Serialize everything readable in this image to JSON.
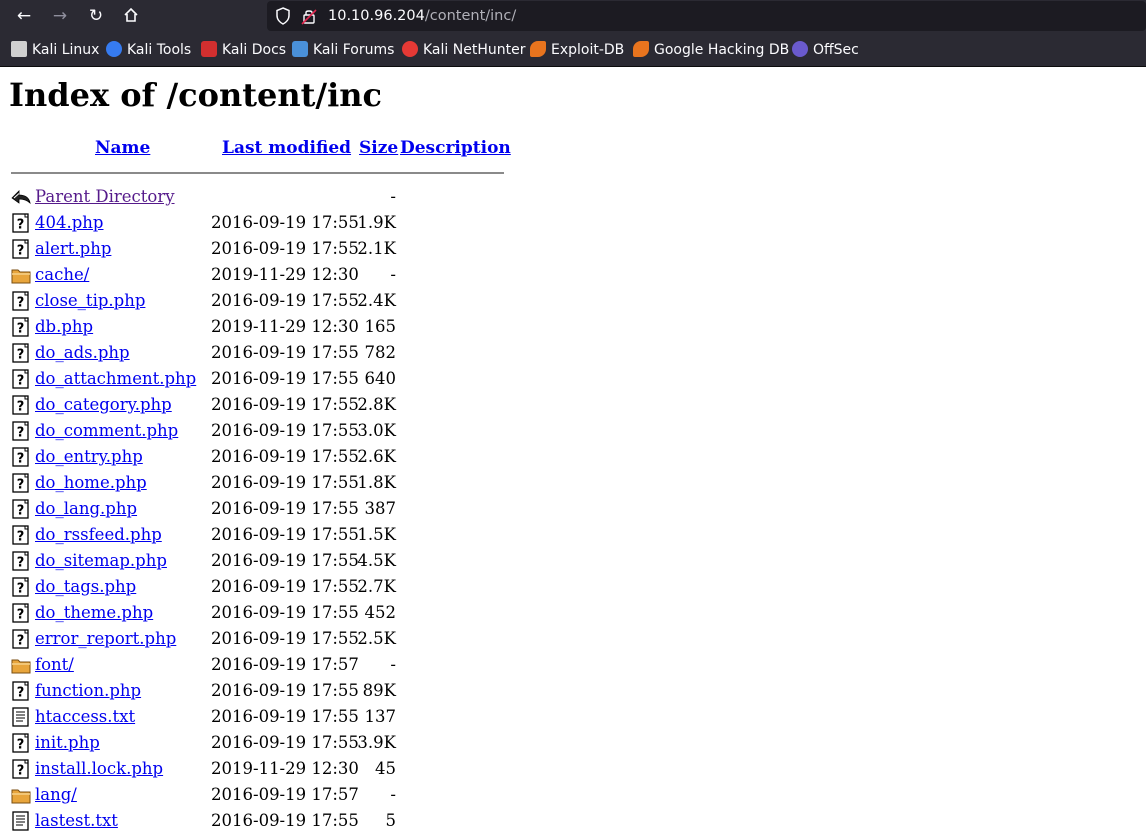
{
  "browser": {
    "url_host": "10.10.96.204",
    "url_path": "/content/inc/",
    "nav": {
      "back_icon": "back-arrow-icon",
      "forward_icon": "forward-arrow-icon",
      "reload_icon": "reload-icon",
      "home_icon": "home-icon"
    },
    "bookmarks": [
      {
        "label": "Kali Linux",
        "icon": "kali-linux-icon",
        "color": "#d0d0d0"
      },
      {
        "label": "Kali Tools",
        "icon": "kali-tools-icon",
        "color": "#367bf0"
      },
      {
        "label": "Kali Docs",
        "icon": "kali-docs-icon",
        "color": "#d32f2f"
      },
      {
        "label": "Kali Forums",
        "icon": "kali-forums-icon",
        "color": "#4a90d9"
      },
      {
        "label": "Kali NetHunter",
        "icon": "kali-nethunter-icon",
        "color": "#e53935"
      },
      {
        "label": "Exploit-DB",
        "icon": "exploit-db-icon",
        "color": "#e8741e"
      },
      {
        "label": "Google Hacking DB",
        "icon": "ghdb-icon",
        "color": "#e8741e"
      },
      {
        "label": "OffSec",
        "icon": "offsec-icon",
        "color": "#6a5acd"
      }
    ]
  },
  "page": {
    "title": "Index of /content/inc",
    "columns": {
      "name": "Name",
      "last_modified": "Last modified",
      "size": "Size",
      "description": "Description"
    },
    "rows": [
      {
        "name": "Parent Directory",
        "modified": "",
        "size": "-",
        "icon": "back-icon"
      },
      {
        "name": "404.php",
        "modified": "2016-09-19 17:55",
        "size": "1.9K",
        "icon": "unknown-file-icon"
      },
      {
        "name": "alert.php",
        "modified": "2016-09-19 17:55",
        "size": "2.1K",
        "icon": "unknown-file-icon"
      },
      {
        "name": "cache/",
        "modified": "2019-11-29 12:30",
        "size": "-",
        "icon": "folder-icon"
      },
      {
        "name": "close_tip.php",
        "modified": "2016-09-19 17:55",
        "size": "2.4K",
        "icon": "unknown-file-icon"
      },
      {
        "name": "db.php",
        "modified": "2019-11-29 12:30",
        "size": "165",
        "icon": "unknown-file-icon"
      },
      {
        "name": "do_ads.php",
        "modified": "2016-09-19 17:55",
        "size": "782",
        "icon": "unknown-file-icon"
      },
      {
        "name": "do_attachment.php",
        "modified": "2016-09-19 17:55",
        "size": "640",
        "icon": "unknown-file-icon"
      },
      {
        "name": "do_category.php",
        "modified": "2016-09-19 17:55",
        "size": "2.8K",
        "icon": "unknown-file-icon"
      },
      {
        "name": "do_comment.php",
        "modified": "2016-09-19 17:55",
        "size": "3.0K",
        "icon": "unknown-file-icon"
      },
      {
        "name": "do_entry.php",
        "modified": "2016-09-19 17:55",
        "size": "2.6K",
        "icon": "unknown-file-icon"
      },
      {
        "name": "do_home.php",
        "modified": "2016-09-19 17:55",
        "size": "1.8K",
        "icon": "unknown-file-icon"
      },
      {
        "name": "do_lang.php",
        "modified": "2016-09-19 17:55",
        "size": "387",
        "icon": "unknown-file-icon"
      },
      {
        "name": "do_rssfeed.php",
        "modified": "2016-09-19 17:55",
        "size": "1.5K",
        "icon": "unknown-file-icon"
      },
      {
        "name": "do_sitemap.php",
        "modified": "2016-09-19 17:55",
        "size": "4.5K",
        "icon": "unknown-file-icon"
      },
      {
        "name": "do_tags.php",
        "modified": "2016-09-19 17:55",
        "size": "2.7K",
        "icon": "unknown-file-icon"
      },
      {
        "name": "do_theme.php",
        "modified": "2016-09-19 17:55",
        "size": "452",
        "icon": "unknown-file-icon"
      },
      {
        "name": "error_report.php",
        "modified": "2016-09-19 17:55",
        "size": "2.5K",
        "icon": "unknown-file-icon"
      },
      {
        "name": "font/",
        "modified": "2016-09-19 17:57",
        "size": "-",
        "icon": "folder-icon"
      },
      {
        "name": "function.php",
        "modified": "2016-09-19 17:55",
        "size": "89K",
        "icon": "unknown-file-icon"
      },
      {
        "name": "htaccess.txt",
        "modified": "2016-09-19 17:55",
        "size": "137",
        "icon": "text-file-icon"
      },
      {
        "name": "init.php",
        "modified": "2016-09-19 17:55",
        "size": "3.9K",
        "icon": "unknown-file-icon"
      },
      {
        "name": "install.lock.php",
        "modified": "2019-11-29 12:30",
        "size": "45",
        "icon": "unknown-file-icon"
      },
      {
        "name": "lang/",
        "modified": "2016-09-19 17:57",
        "size": "-",
        "icon": "folder-icon"
      },
      {
        "name": "lastest.txt",
        "modified": "2016-09-19 17:55",
        "size": "5",
        "icon": "text-file-icon"
      }
    ]
  }
}
